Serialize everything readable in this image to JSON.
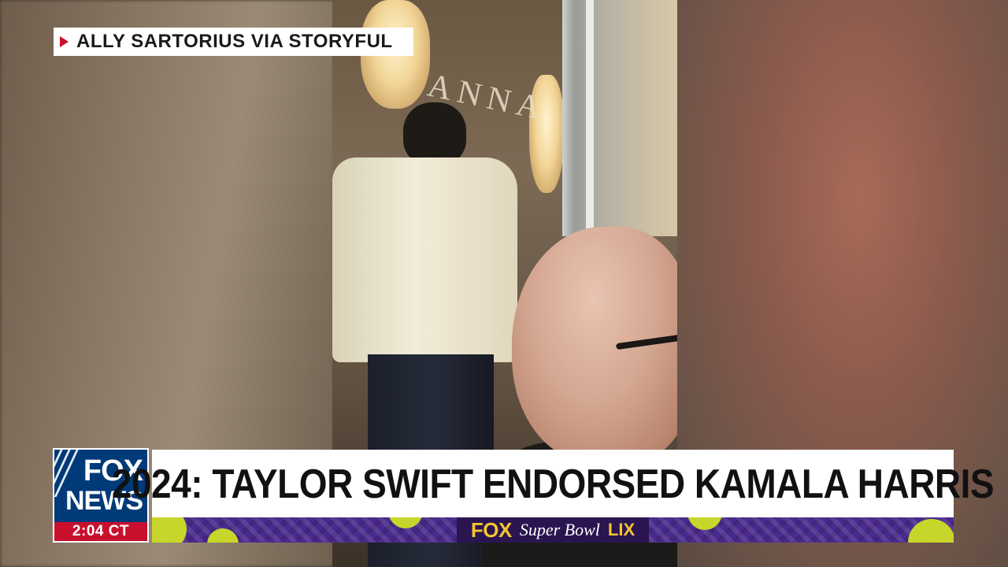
{
  "credit": {
    "icon": "play-triangle-icon",
    "text": "ALLY SARTORIUS VIA STORYFUL",
    "icon_color": "#c8102e"
  },
  "logo": {
    "line1": "FOX",
    "line2": "NEWS",
    "time": "2:04 CT",
    "colors": {
      "blue": "#003a78",
      "red": "#c8102e"
    }
  },
  "headline": {
    "text": "2024: TAYLOR SWIFT ENDORSED KAMALA HARRIS"
  },
  "promo": {
    "brand": "FOX",
    "event": "Super Bowl",
    "numeral": "LIX",
    "colors": {
      "background": "#4b2a8e",
      "accent": "#f4c430",
      "lime": "#c8d52a"
    }
  },
  "video": {
    "sign_text": "ANNA"
  }
}
